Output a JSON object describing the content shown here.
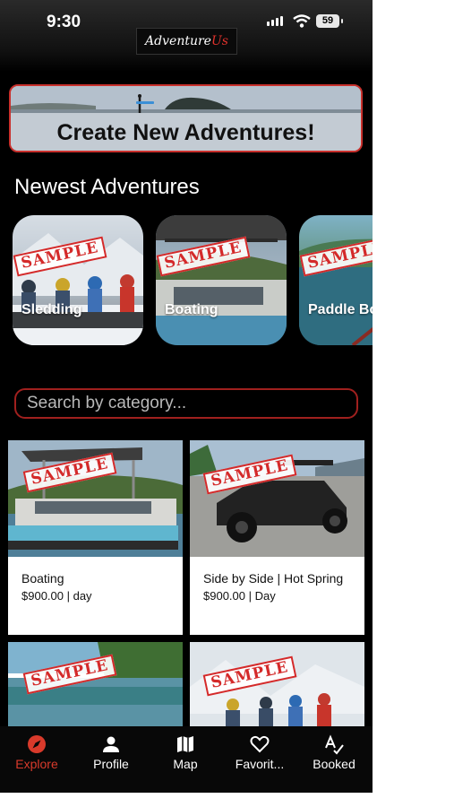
{
  "status": {
    "time": "9:30",
    "battery": "59"
  },
  "app": {
    "logo_main": "Adventure",
    "logo_accent": "Us"
  },
  "banner": {
    "label": "Create New Adventures!"
  },
  "newest": {
    "title": "Newest Adventures",
    "items": [
      {
        "label": "Sledding",
        "stamp": "SAMPLE"
      },
      {
        "label": "Boating",
        "stamp": "SAMPLE"
      },
      {
        "label": "Paddle Bo",
        "stamp": "SAMPLE"
      }
    ]
  },
  "search": {
    "placeholder": "Search by category..."
  },
  "listings": [
    {
      "title": "Boating",
      "price": "$900.00 | day",
      "stamp": "SAMPLE"
    },
    {
      "title": "Side by Side | Hot Spring",
      "price": "$900.00 | Day",
      "stamp": "SAMPLE"
    },
    {
      "title": "",
      "price": "",
      "stamp": "SAMPLE"
    },
    {
      "title": "",
      "price": "",
      "stamp": "SAMPLE"
    }
  ],
  "tabs": [
    {
      "label": "Explore",
      "icon": "compass-icon",
      "active": true
    },
    {
      "label": "Profile",
      "icon": "person-icon",
      "active": false
    },
    {
      "label": "Map",
      "icon": "map-icon",
      "active": false
    },
    {
      "label": "Favorit...",
      "icon": "heart-icon",
      "active": false
    },
    {
      "label": "Booked",
      "icon": "booked-icon",
      "active": false
    }
  ],
  "colors": {
    "accent": "#d93a2b",
    "background": "#000000",
    "border_red": "#c9302c"
  }
}
